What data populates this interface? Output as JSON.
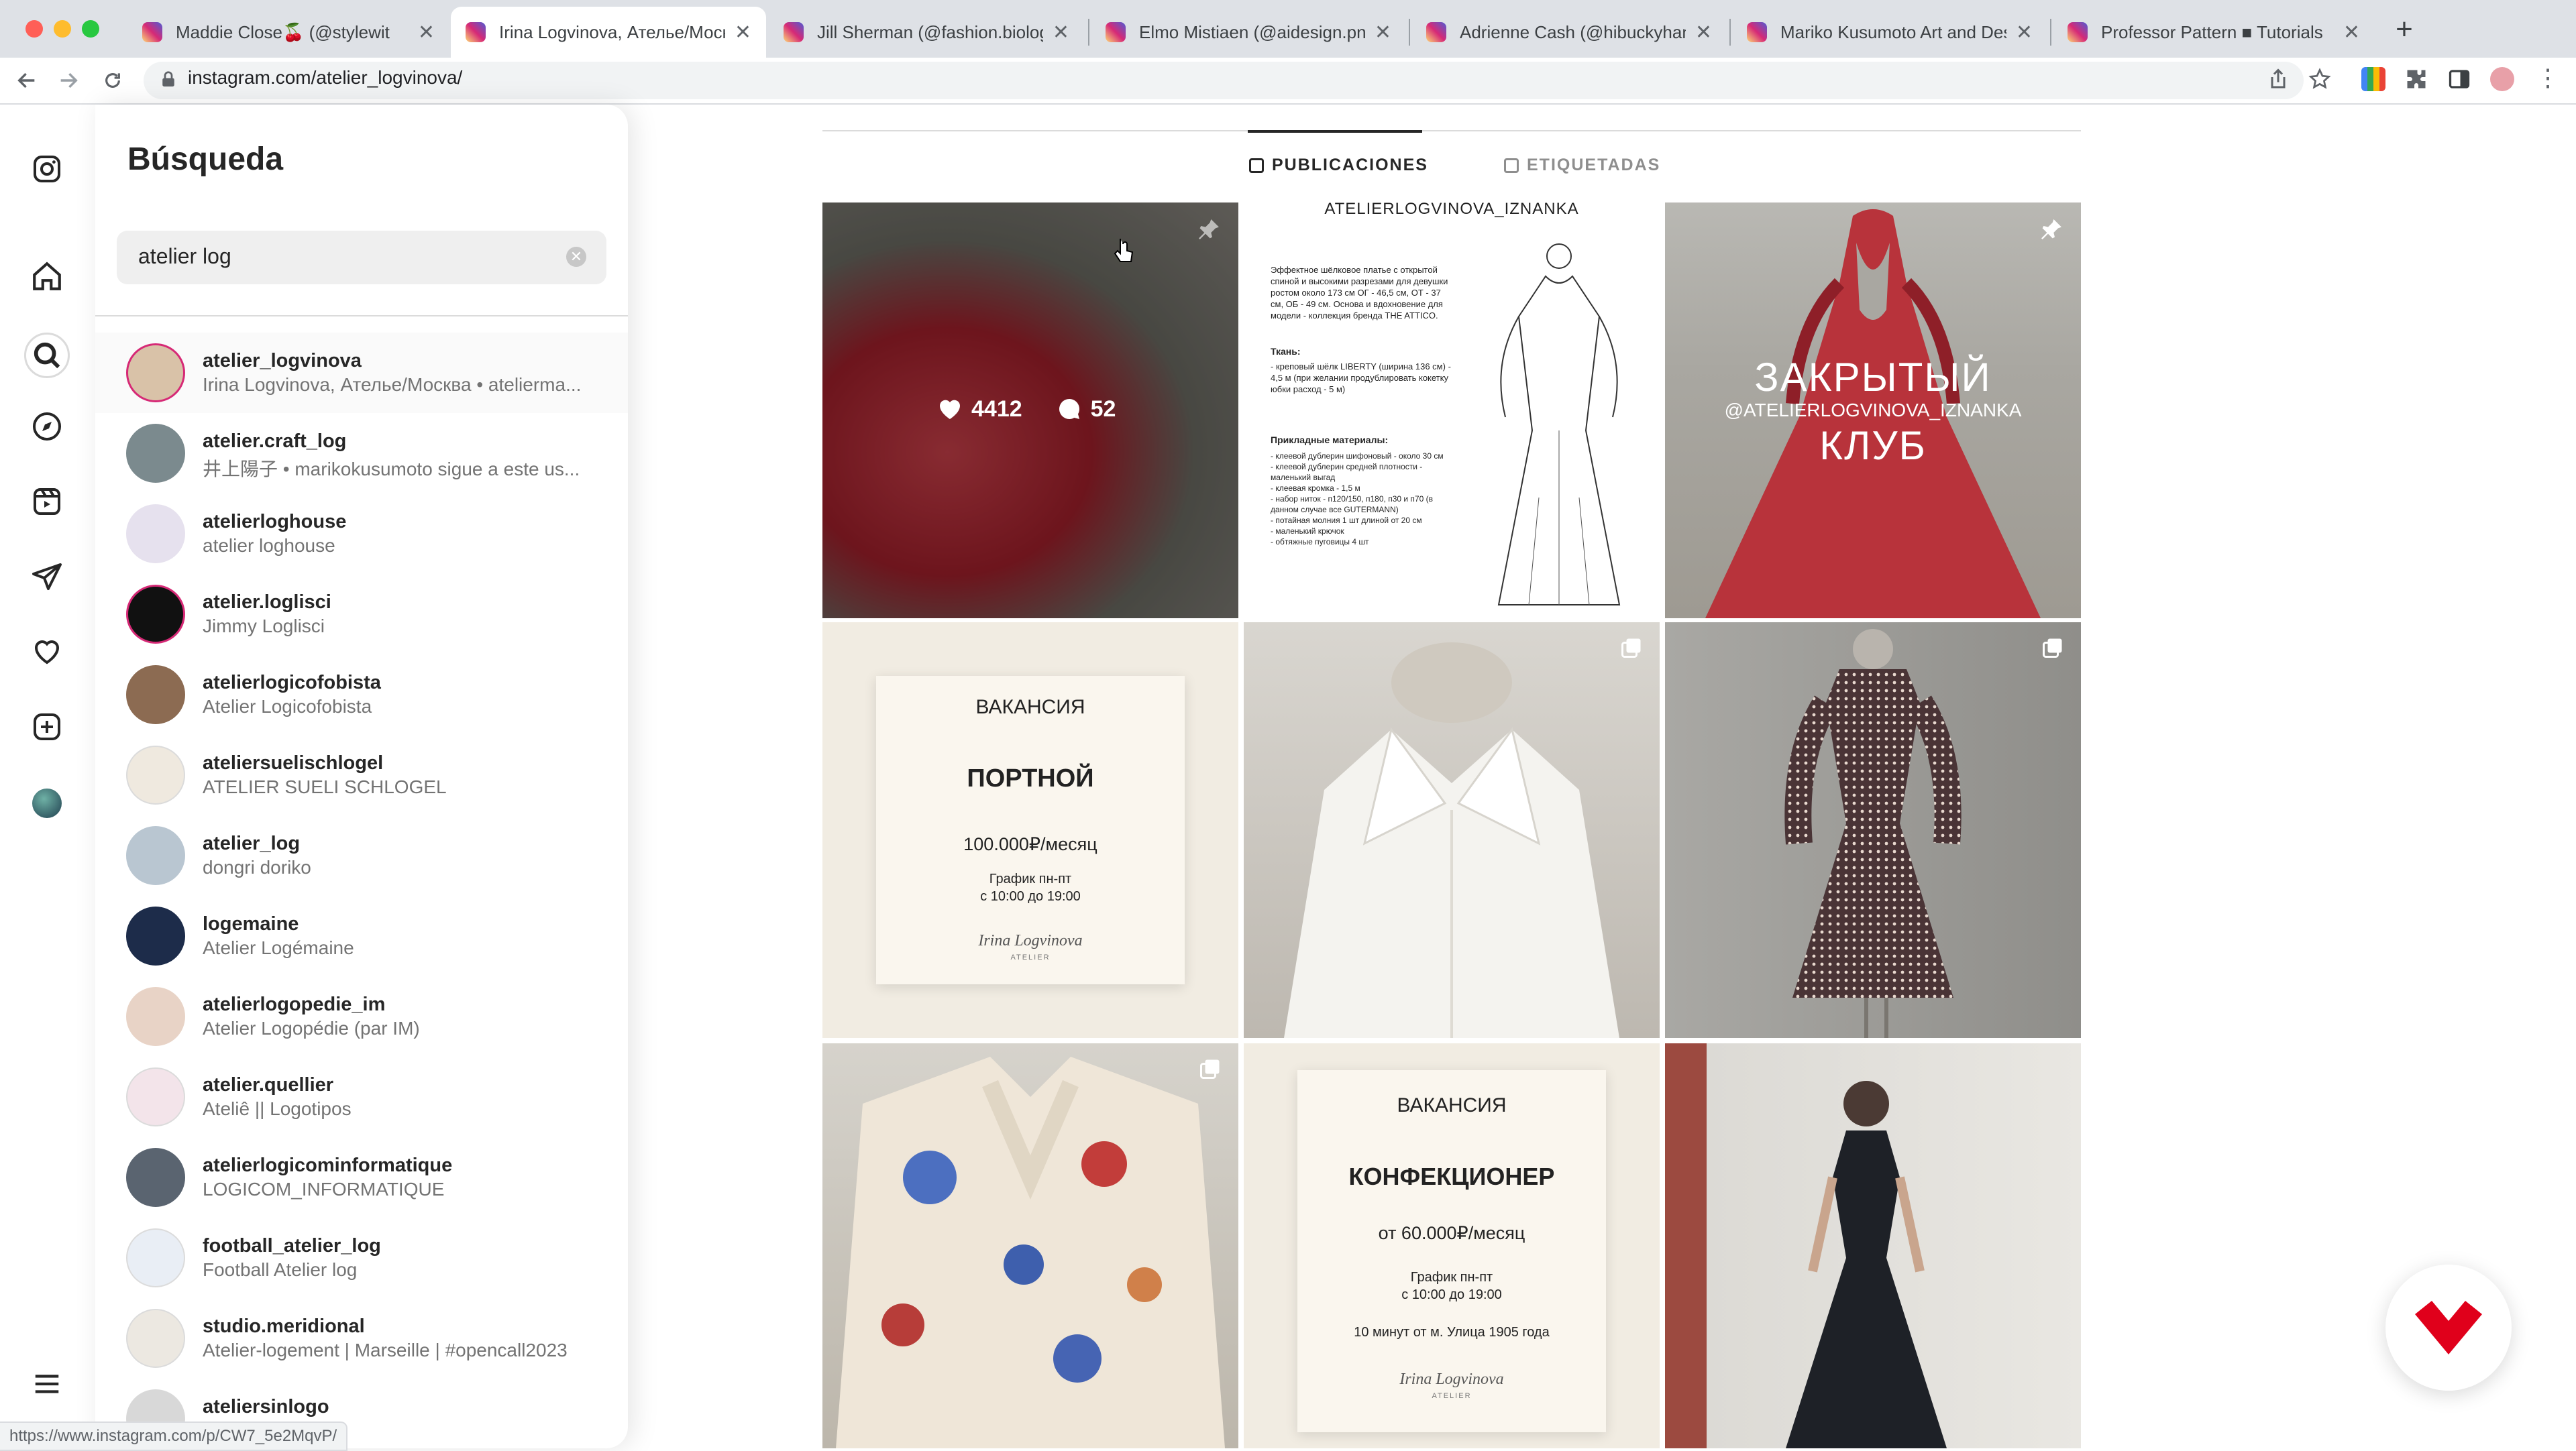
{
  "browser": {
    "tabs": [
      {
        "title": "Maddie Close🍒 (@stylewit",
        "active": false
      },
      {
        "title": "Irina Logvinova, Ателье/Моск",
        "active": true
      },
      {
        "title": "Jill Sherman (@fashion.biologi",
        "active": false
      },
      {
        "title": "Elmo Mistiaen (@aidesign.png)",
        "active": false
      },
      {
        "title": "Adrienne Cash (@hibuckyhand",
        "active": false
      },
      {
        "title": "Mariko Kusumoto Art and Desi",
        "active": false
      },
      {
        "title": "Professor Pattern ■ Tutorials",
        "active": false
      }
    ],
    "close_glyph": "✕",
    "new_tab_glyph": "+",
    "url": "instagram.com/atelier_logvinova/",
    "status_url": "https://www.instagram.com/p/CW7_5e2MqvP/"
  },
  "search": {
    "title": "Búsqueda",
    "query": "atelier log",
    "clear_glyph": "✕",
    "results": [
      {
        "username": "atelier_logvinova",
        "fullname": "Irina Logvinova, Ателье/Москва • ateliermа...",
        "avatar_color": "#d9c2a8"
      },
      {
        "username": "atelier.craft_log",
        "fullname": "井上陽子 • marikokusumoto sigue a este us...",
        "avatar_color": "#7b8a8e"
      },
      {
        "username": "atelierloghouse",
        "fullname": "atelier loghouse",
        "avatar_color": "#e6e1ee"
      },
      {
        "username": "atelier.loglisci",
        "fullname": "Jimmy Loglisci",
        "avatar_color": "#111111"
      },
      {
        "username": "atelierlogicofobista",
        "fullname": "Atelier Logicofobista",
        "avatar_color": "#8c6b52"
      },
      {
        "username": "ateliersuelischlogel",
        "fullname": "ATELIER SUELI SCHLOGEL",
        "avatar_color": "#efe9df"
      },
      {
        "username": "atelier_log",
        "fullname": "dongri doriko",
        "avatar_color": "#b9c6d1"
      },
      {
        "username": "logemaine",
        "fullname": "Atelier Logémaine",
        "avatar_color": "#1d2c4a"
      },
      {
        "username": "atelierlogopedie_im",
        "fullname": "Atelier Logopédie (par IM)",
        "avatar_color": "#e8d3c6"
      },
      {
        "username": "atelier.quellier",
        "fullname": "Ateliê || Logotipos",
        "avatar_color": "#f3e4ea"
      },
      {
        "username": "atelierlogicominformatique",
        "fullname": "LOGICOM_INFORMATIQUE",
        "avatar_color": "#5a6470"
      },
      {
        "username": "football_atelier_log",
        "fullname": "Football Atelier log",
        "avatar_color": "#e9eef5"
      },
      {
        "username": "studio.meridional",
        "fullname": "Atelier-logement | Marseille | #opencall2023",
        "avatar_color": "#ece8e1"
      },
      {
        "username": "ateliersinlogo",
        "fullname": "",
        "avatar_color": "#d8d8d8"
      }
    ]
  },
  "profile": {
    "tabs": [
      {
        "label": "PUBLICACIONES",
        "active": true
      },
      {
        "label": "ETIQUETADAS",
        "active": false
      }
    ],
    "posts": {
      "p1": {
        "likes": "4412",
        "comments": "52"
      },
      "p2": {
        "header": "ATELIERLOGVINOVA_IZNANKA",
        "intro": "Эффектное шёлковое платье с открытой спиной и высокими разрезами для девушки ростом около 173 см ОГ - 46,5 см, ОТ - 37 см, ОБ - 49 см. Основа и вдохновение для модели - коллекция бренда THE ATTICO.",
        "fabric_title": "Ткань:",
        "fabric": "- креповый шёлк LIBERTY (ширина 136 см) - 4,5 м (при желании продублировать кокетку юбки расход - 5 м)",
        "materials_title": "Прикладные материалы:",
        "materials": [
          "- клеевой дублерин шифоновый - около 30 см",
          "- клеевой дублерин средней плотности - маленький выгад",
          "- клеевая кромка - 1,5 м",
          "- набор ниток - п120/150, п180, п30 и п70 (в данном случае все GUTERMANN)",
          "- потайная молния 1 шт длиной от 20 см",
          "- маленький крючок",
          "- обтяжные пуговицы 4 шт"
        ]
      },
      "p3": {
        "line1": "ЗАКРЫТЫЙ",
        "handle": "@ATELIERLOGVINOVA_IZNANKA",
        "line2": "КЛУБ"
      },
      "p4": {
        "heading": "ВАКАНСИЯ",
        "role": "ПОРТНОЙ",
        "salary": "100.000₽/месяц",
        "schedule": "График пн-пт",
        "hours": "с 10:00 до 19:00",
        "signature": "Irina Logvinova",
        "sig_sub": "ATELIER"
      },
      "p8": {
        "heading": "ВАКАНСИЯ",
        "role": "КОНФЕКЦИОНЕР",
        "salary": "от 60.000₽/месяц",
        "schedule": "График пн-пт",
        "hours": "с 10:00 до 19:00",
        "location": "10 минут от м. Улица 1905 года",
        "signature": "Irina Logvinova",
        "sig_sub": "ATELIER"
      }
    }
  },
  "colors": {
    "accent": "#0095f6",
    "fab": "#e0001b"
  }
}
